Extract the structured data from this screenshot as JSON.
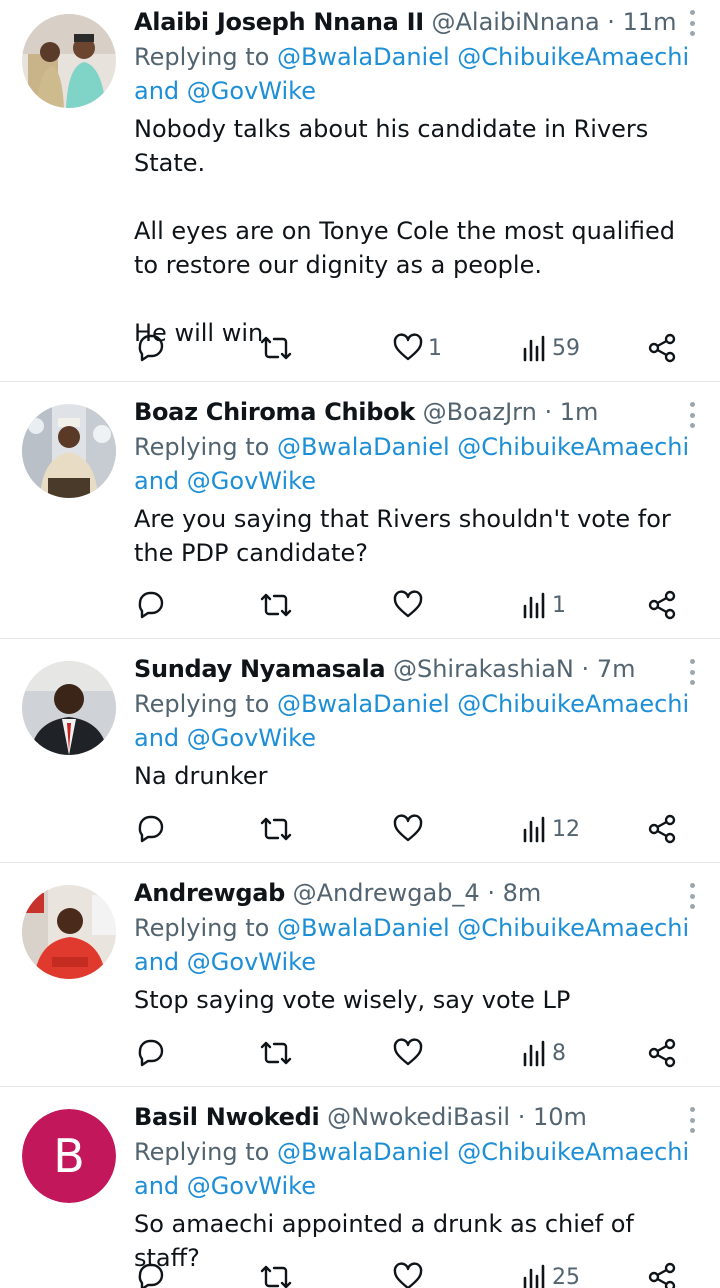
{
  "replies": [
    {
      "name": "Alaibi Joseph Nnana II",
      "handle": "@AlaibiNnana",
      "time": "11m",
      "replying_to": "Replying to",
      "mention1": "@BwalaDaniel",
      "mention2": "@ChibuikeAmaechi",
      "and": "and",
      "mention3": "@GovWike",
      "body": [
        "Nobody talks about his candidate in Rivers State.",
        "All eyes are on Tonye Cole the most qualified to restore our dignity as a people.",
        "He will win."
      ],
      "likes": "1",
      "views": "59"
    },
    {
      "name": "Boaz Chiroma Chibok",
      "handle": "@BoazJrn",
      "time": "1m",
      "replying_to": "Replying to",
      "mention1": "@BwalaDaniel",
      "mention2": "@ChibuikeAmaechi",
      "and": "and",
      "mention3": "@GovWike",
      "body": [
        "Are you saying that Rivers shouldn't vote for the PDP candidate?"
      ],
      "likes": "",
      "views": "1"
    },
    {
      "name": "Sunday Nyamasala",
      "handle": "@ShirakashiaN",
      "time": "7m",
      "replying_to": "Replying to",
      "mention1": "@BwalaDaniel",
      "mention2": "@ChibuikeAmaechi",
      "and": "and",
      "mention3": "@GovWike",
      "body": [
        "Na drunker"
      ],
      "likes": "",
      "views": "12"
    },
    {
      "name": "Andrewgab",
      "handle": "@Andrewgab_4",
      "time": "8m",
      "replying_to": "Replying to",
      "mention1": "@BwalaDaniel",
      "mention2": "@ChibuikeAmaechi",
      "and": "and",
      "mention3": "@GovWike",
      "body": [
        "Stop saying vote wisely, say vote LP"
      ],
      "likes": "",
      "views": "8"
    },
    {
      "name": "Basil Nwokedi",
      "handle": "@NwokediBasil",
      "time": "10m",
      "avatar_letter": "B",
      "replying_to": "Replying to",
      "mention1": "@BwalaDaniel",
      "mention2": "@ChibuikeAmaechi",
      "and": "and",
      "mention3": "@GovWike",
      "body": [
        "So amaechi appointed a drunk as chief of staff?"
      ],
      "likes": "",
      "views": "25"
    }
  ],
  "separator": "·",
  "icons": {
    "reply": "comment-icon",
    "retweet": "retweet-icon",
    "like": "heart-icon",
    "views": "views-icon",
    "share": "share-icon",
    "more": "more-options-icon"
  },
  "colors": {
    "mention": "#1d8fd6",
    "muted": "#536471",
    "avatar_letter_bg": "#c2185b"
  }
}
